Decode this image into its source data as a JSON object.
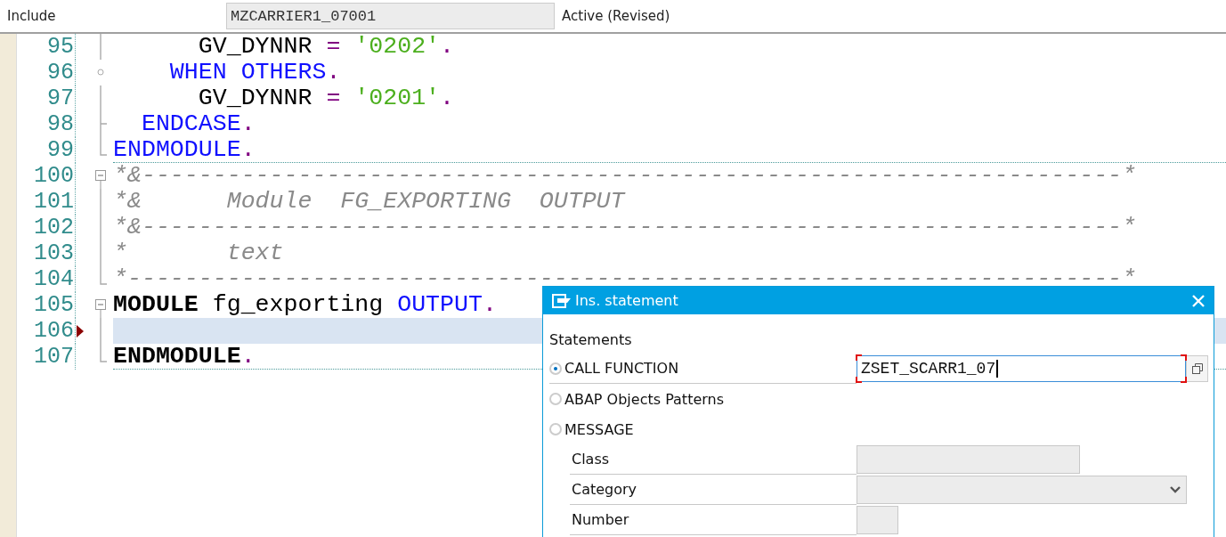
{
  "header": {
    "label": "Include",
    "program": "MZCARRIER1_07001",
    "status": "Active (Revised)"
  },
  "lines": [
    {
      "number": "95",
      "kind": "line",
      "selected": false,
      "separator": false,
      "tokens": [
        {
          "kind": "plain",
          "text": "      GV_DYNNR "
        },
        {
          "kind": "punct",
          "text": "="
        },
        {
          "kind": "string",
          "text": " '0202'"
        },
        {
          "kind": "punct",
          "text": "."
        }
      ]
    },
    {
      "number": "96",
      "kind": "node",
      "selected": false,
      "separator": false,
      "tokens": [
        {
          "kind": "keyword",
          "text": "    WHEN OTHERS"
        },
        {
          "kind": "punct",
          "text": "."
        }
      ]
    },
    {
      "number": "97",
      "kind": "line",
      "selected": false,
      "separator": false,
      "tokens": [
        {
          "kind": "plain",
          "text": "      GV_DYNNR "
        },
        {
          "kind": "punct",
          "text": "="
        },
        {
          "kind": "string",
          "text": " '0201'"
        },
        {
          "kind": "punct",
          "text": "."
        }
      ]
    },
    {
      "number": "98",
      "kind": "tick",
      "selected": false,
      "separator": false,
      "tokens": [
        {
          "kind": "keyword",
          "text": "  ENDCASE"
        },
        {
          "kind": "punct",
          "text": "."
        }
      ]
    },
    {
      "number": "99",
      "kind": "end",
      "selected": false,
      "separator": true,
      "tokens": [
        {
          "kind": "keyword",
          "text": "ENDMODULE"
        },
        {
          "kind": "punct",
          "text": "."
        }
      ]
    },
    {
      "number": "100",
      "kind": "box",
      "selected": false,
      "separator": false,
      "tokens": [
        {
          "kind": "comment",
          "text": "*&---------------------------------------------------------------------*"
        }
      ]
    },
    {
      "number": "101",
      "kind": "line",
      "selected": false,
      "separator": false,
      "tokens": [
        {
          "kind": "comment",
          "text": "*&      Module  FG_EXPORTING  OUTPUT"
        }
      ]
    },
    {
      "number": "102",
      "kind": "line",
      "selected": false,
      "separator": false,
      "tokens": [
        {
          "kind": "comment",
          "text": "*&---------------------------------------------------------------------*"
        }
      ]
    },
    {
      "number": "103",
      "kind": "line",
      "selected": false,
      "separator": false,
      "tokens": [
        {
          "kind": "comment",
          "text": "*       text"
        }
      ]
    },
    {
      "number": "104",
      "kind": "end",
      "selected": false,
      "separator": false,
      "tokens": [
        {
          "kind": "comment",
          "text": "*----------------------------------------------------------------------*"
        }
      ]
    },
    {
      "number": "105",
      "kind": "box",
      "selected": false,
      "separator": false,
      "tokens": [
        {
          "kind": "bold",
          "text": "MODULE"
        },
        {
          "kind": "plain",
          "text": " fg_exporting "
        },
        {
          "kind": "keyword",
          "text": "OUTPUT"
        },
        {
          "kind": "punct",
          "text": "."
        }
      ]
    },
    {
      "number": "106",
      "kind": "line",
      "selected": true,
      "separator": false
    },
    {
      "number": "107",
      "kind": "end",
      "selected": false,
      "separator": true,
      "tokens": [
        {
          "kind": "bold",
          "text": "ENDMODULE"
        },
        {
          "kind": "punct",
          "text": "."
        }
      ]
    }
  ],
  "dialog": {
    "title": "Ins. statement",
    "section": "Statements",
    "options": [
      {
        "label": "CALL FUNCTION",
        "selected": true,
        "value": "ZSET_SCARR1_07"
      },
      {
        "label": "ABAP Objects Patterns",
        "selected": false
      },
      {
        "label": "MESSAGE",
        "selected": false
      }
    ],
    "fields": [
      {
        "label": "Class",
        "kind": "text"
      },
      {
        "label": "Category",
        "kind": "dropdown"
      },
      {
        "label": "Number",
        "kind": "short"
      }
    ]
  }
}
